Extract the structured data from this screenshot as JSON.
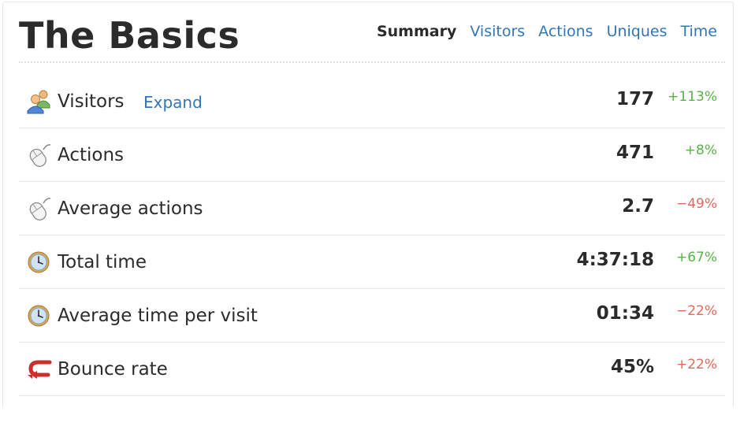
{
  "header": {
    "title": "The Basics",
    "tabs": [
      {
        "label": "Summary",
        "active": true
      },
      {
        "label": "Visitors",
        "active": false
      },
      {
        "label": "Actions",
        "active": false
      },
      {
        "label": "Uniques",
        "active": false
      },
      {
        "label": "Time",
        "active": false
      }
    ]
  },
  "colors": {
    "link": "#3275b8",
    "positive": "#57b347",
    "negative": "#e0695a",
    "text": "#2b2b2b"
  },
  "rows": [
    {
      "icon": "visitors-icon",
      "label": "Visitors",
      "expand_label": "Expand",
      "value": "177",
      "change": "+113%",
      "trend": "positive"
    },
    {
      "icon": "mouse-icon",
      "label": "Actions",
      "value": "471",
      "change": "+8%",
      "trend": "positive"
    },
    {
      "icon": "mouse-icon",
      "label": "Average actions",
      "value": "2.7",
      "change": "−49%",
      "trend": "negative"
    },
    {
      "icon": "clock-icon",
      "label": "Total time",
      "value": "4:37:18",
      "change": "+67%",
      "trend": "positive"
    },
    {
      "icon": "clock-icon",
      "label": "Average time per visit",
      "value": "01:34",
      "change": "−22%",
      "trend": "negative"
    },
    {
      "icon": "bounce-arrow-icon",
      "label": "Bounce rate",
      "value": "45%",
      "change": "+22%",
      "trend": "negative"
    }
  ]
}
